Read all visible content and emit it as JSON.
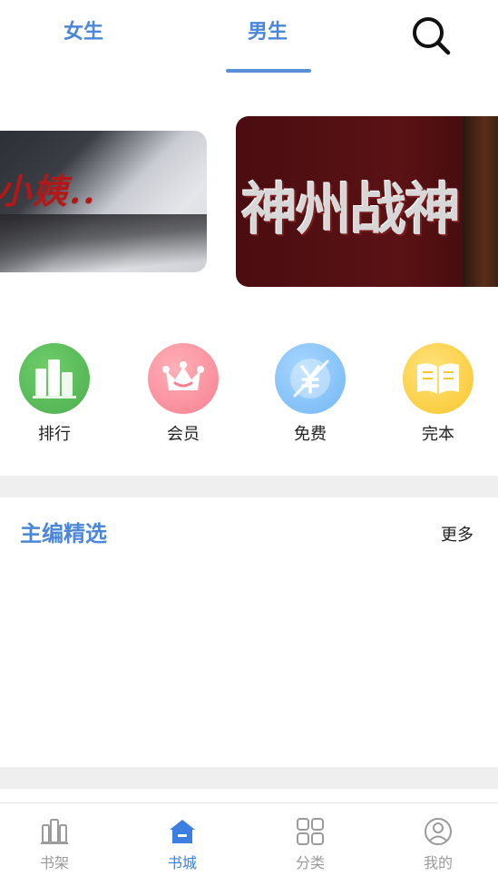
{
  "tabs": {
    "female": "女生",
    "male": "男生",
    "active": "男生"
  },
  "icons": {
    "search": "search-icon",
    "shelf": "bookshelf-icon",
    "store": "home-icon",
    "category": "grid-icon",
    "mine": "user-icon"
  },
  "banners": [
    {
      "title": "小姨.."
    },
    {
      "title": "神州战神"
    }
  ],
  "categories": [
    {
      "label": "排行",
      "icon": "bar-chart-icon",
      "color": "#4caf50"
    },
    {
      "label": "会员",
      "icon": "crown-icon",
      "color": "#f7808f"
    },
    {
      "label": "免费",
      "icon": "yen-icon",
      "color": "#72b7f5"
    },
    {
      "label": "完本",
      "icon": "open-book-icon",
      "color": "#f9c62e"
    }
  ],
  "section": {
    "title": "主编精选",
    "more": "更多"
  },
  "bottom_nav": [
    {
      "label": "书架",
      "active": false
    },
    {
      "label": "书城",
      "active": true
    },
    {
      "label": "分类",
      "active": false
    },
    {
      "label": "我的",
      "active": false
    }
  ],
  "colors": {
    "accent": "#4a87d8",
    "nav_active": "#3d7fe0",
    "nav_inactive": "#9a9a9a"
  }
}
